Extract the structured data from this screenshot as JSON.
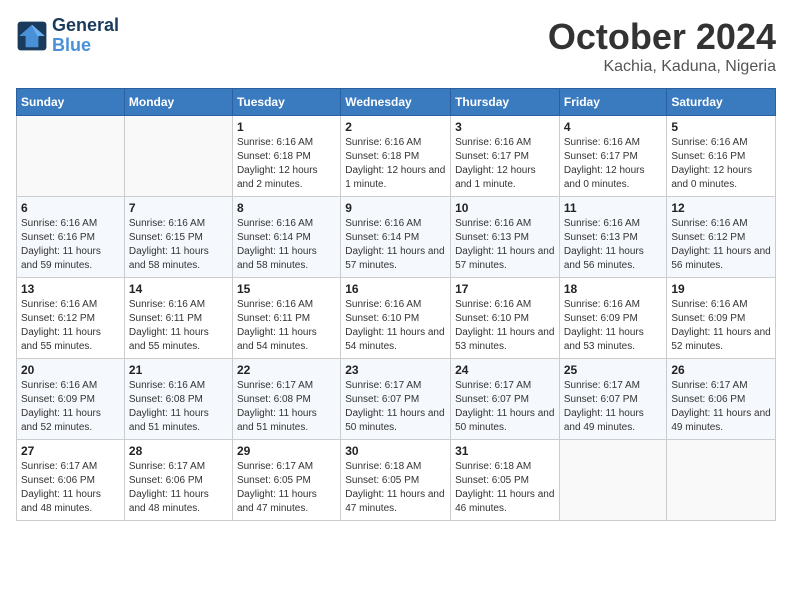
{
  "header": {
    "logo_line1": "General",
    "logo_line2": "Blue",
    "month_title": "October 2024",
    "subtitle": "Kachia, Kaduna, Nigeria"
  },
  "weekdays": [
    "Sunday",
    "Monday",
    "Tuesday",
    "Wednesday",
    "Thursday",
    "Friday",
    "Saturday"
  ],
  "weeks": [
    [
      {
        "day": "",
        "sunrise": "",
        "sunset": "",
        "daylight": ""
      },
      {
        "day": "",
        "sunrise": "",
        "sunset": "",
        "daylight": ""
      },
      {
        "day": "1",
        "sunrise": "Sunrise: 6:16 AM",
        "sunset": "Sunset: 6:18 PM",
        "daylight": "Daylight: 12 hours and 2 minutes."
      },
      {
        "day": "2",
        "sunrise": "Sunrise: 6:16 AM",
        "sunset": "Sunset: 6:18 PM",
        "daylight": "Daylight: 12 hours and 1 minute."
      },
      {
        "day": "3",
        "sunrise": "Sunrise: 6:16 AM",
        "sunset": "Sunset: 6:17 PM",
        "daylight": "Daylight: 12 hours and 1 minute."
      },
      {
        "day": "4",
        "sunrise": "Sunrise: 6:16 AM",
        "sunset": "Sunset: 6:17 PM",
        "daylight": "Daylight: 12 hours and 0 minutes."
      },
      {
        "day": "5",
        "sunrise": "Sunrise: 6:16 AM",
        "sunset": "Sunset: 6:16 PM",
        "daylight": "Daylight: 12 hours and 0 minutes."
      }
    ],
    [
      {
        "day": "6",
        "sunrise": "Sunrise: 6:16 AM",
        "sunset": "Sunset: 6:16 PM",
        "daylight": "Daylight: 11 hours and 59 minutes."
      },
      {
        "day": "7",
        "sunrise": "Sunrise: 6:16 AM",
        "sunset": "Sunset: 6:15 PM",
        "daylight": "Daylight: 11 hours and 58 minutes."
      },
      {
        "day": "8",
        "sunrise": "Sunrise: 6:16 AM",
        "sunset": "Sunset: 6:14 PM",
        "daylight": "Daylight: 11 hours and 58 minutes."
      },
      {
        "day": "9",
        "sunrise": "Sunrise: 6:16 AM",
        "sunset": "Sunset: 6:14 PM",
        "daylight": "Daylight: 11 hours and 57 minutes."
      },
      {
        "day": "10",
        "sunrise": "Sunrise: 6:16 AM",
        "sunset": "Sunset: 6:13 PM",
        "daylight": "Daylight: 11 hours and 57 minutes."
      },
      {
        "day": "11",
        "sunrise": "Sunrise: 6:16 AM",
        "sunset": "Sunset: 6:13 PM",
        "daylight": "Daylight: 11 hours and 56 minutes."
      },
      {
        "day": "12",
        "sunrise": "Sunrise: 6:16 AM",
        "sunset": "Sunset: 6:12 PM",
        "daylight": "Daylight: 11 hours and 56 minutes."
      }
    ],
    [
      {
        "day": "13",
        "sunrise": "Sunrise: 6:16 AM",
        "sunset": "Sunset: 6:12 PM",
        "daylight": "Daylight: 11 hours and 55 minutes."
      },
      {
        "day": "14",
        "sunrise": "Sunrise: 6:16 AM",
        "sunset": "Sunset: 6:11 PM",
        "daylight": "Daylight: 11 hours and 55 minutes."
      },
      {
        "day": "15",
        "sunrise": "Sunrise: 6:16 AM",
        "sunset": "Sunset: 6:11 PM",
        "daylight": "Daylight: 11 hours and 54 minutes."
      },
      {
        "day": "16",
        "sunrise": "Sunrise: 6:16 AM",
        "sunset": "Sunset: 6:10 PM",
        "daylight": "Daylight: 11 hours and 54 minutes."
      },
      {
        "day": "17",
        "sunrise": "Sunrise: 6:16 AM",
        "sunset": "Sunset: 6:10 PM",
        "daylight": "Daylight: 11 hours and 53 minutes."
      },
      {
        "day": "18",
        "sunrise": "Sunrise: 6:16 AM",
        "sunset": "Sunset: 6:09 PM",
        "daylight": "Daylight: 11 hours and 53 minutes."
      },
      {
        "day": "19",
        "sunrise": "Sunrise: 6:16 AM",
        "sunset": "Sunset: 6:09 PM",
        "daylight": "Daylight: 11 hours and 52 minutes."
      }
    ],
    [
      {
        "day": "20",
        "sunrise": "Sunrise: 6:16 AM",
        "sunset": "Sunset: 6:09 PM",
        "daylight": "Daylight: 11 hours and 52 minutes."
      },
      {
        "day": "21",
        "sunrise": "Sunrise: 6:16 AM",
        "sunset": "Sunset: 6:08 PM",
        "daylight": "Daylight: 11 hours and 51 minutes."
      },
      {
        "day": "22",
        "sunrise": "Sunrise: 6:17 AM",
        "sunset": "Sunset: 6:08 PM",
        "daylight": "Daylight: 11 hours and 51 minutes."
      },
      {
        "day": "23",
        "sunrise": "Sunrise: 6:17 AM",
        "sunset": "Sunset: 6:07 PM",
        "daylight": "Daylight: 11 hours and 50 minutes."
      },
      {
        "day": "24",
        "sunrise": "Sunrise: 6:17 AM",
        "sunset": "Sunset: 6:07 PM",
        "daylight": "Daylight: 11 hours and 50 minutes."
      },
      {
        "day": "25",
        "sunrise": "Sunrise: 6:17 AM",
        "sunset": "Sunset: 6:07 PM",
        "daylight": "Daylight: 11 hours and 49 minutes."
      },
      {
        "day": "26",
        "sunrise": "Sunrise: 6:17 AM",
        "sunset": "Sunset: 6:06 PM",
        "daylight": "Daylight: 11 hours and 49 minutes."
      }
    ],
    [
      {
        "day": "27",
        "sunrise": "Sunrise: 6:17 AM",
        "sunset": "Sunset: 6:06 PM",
        "daylight": "Daylight: 11 hours and 48 minutes."
      },
      {
        "day": "28",
        "sunrise": "Sunrise: 6:17 AM",
        "sunset": "Sunset: 6:06 PM",
        "daylight": "Daylight: 11 hours and 48 minutes."
      },
      {
        "day": "29",
        "sunrise": "Sunrise: 6:17 AM",
        "sunset": "Sunset: 6:05 PM",
        "daylight": "Daylight: 11 hours and 47 minutes."
      },
      {
        "day": "30",
        "sunrise": "Sunrise: 6:18 AM",
        "sunset": "Sunset: 6:05 PM",
        "daylight": "Daylight: 11 hours and 47 minutes."
      },
      {
        "day": "31",
        "sunrise": "Sunrise: 6:18 AM",
        "sunset": "Sunset: 6:05 PM",
        "daylight": "Daylight: 11 hours and 46 minutes."
      },
      {
        "day": "",
        "sunrise": "",
        "sunset": "",
        "daylight": ""
      },
      {
        "day": "",
        "sunrise": "",
        "sunset": "",
        "daylight": ""
      }
    ]
  ]
}
